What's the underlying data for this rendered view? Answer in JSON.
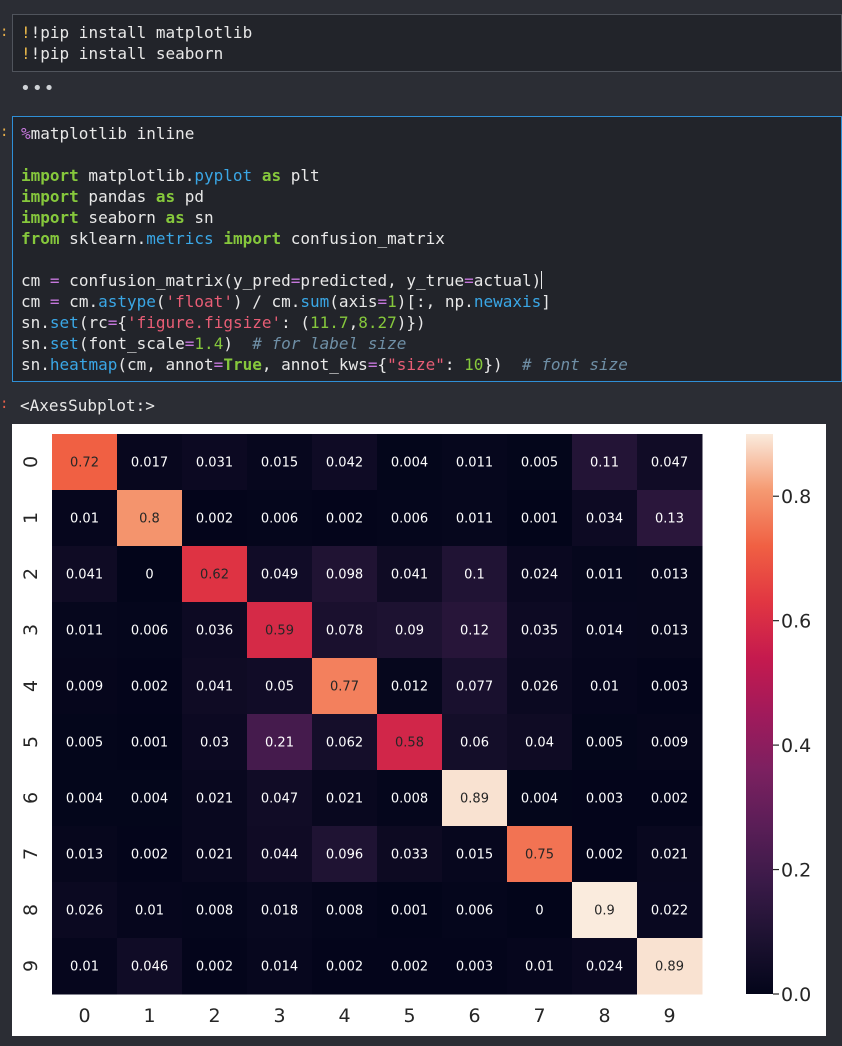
{
  "cells": {
    "cell1": {
      "lines": [
        "!pip install matplotlib",
        "!pip install seaborn"
      ]
    },
    "cell1_collapsed_indicator": "•••",
    "cell2": {
      "lines": [
        "%matplotlib inline",
        "",
        "import matplotlib.pyplot as plt",
        "import pandas as pd",
        "import seaborn as sn",
        "from sklearn.metrics import confusion_matrix",
        "",
        "cm = confusion_matrix(y_pred=predicted, y_true=actual)",
        "cm = cm.astype('float') / cm.sum(axis=1)[:, np.newaxis]",
        "sn.set(rc={'figure.figsize': (11.7,8.27)})",
        "sn.set(font_scale=1.4)  # for label size",
        "sn.heatmap(cm, annot=True, annot_kws={\"size\": 10})  # font size"
      ]
    },
    "output_text": "<AxesSubplot:>"
  },
  "chart_data": {
    "type": "heatmap",
    "x_categories": [
      "0",
      "1",
      "2",
      "3",
      "4",
      "5",
      "6",
      "7",
      "8",
      "9"
    ],
    "y_categories": [
      "0",
      "1",
      "2",
      "3",
      "4",
      "5",
      "6",
      "7",
      "8",
      "9"
    ],
    "values": [
      [
        0.72,
        0.017,
        0.031,
        0.015,
        0.042,
        0.004,
        0.011,
        0.005,
        0.11,
        0.047
      ],
      [
        0.01,
        0.8,
        0.002,
        0.006,
        0.002,
        0.006,
        0.011,
        0.001,
        0.034,
        0.13
      ],
      [
        0.041,
        0,
        0.62,
        0.049,
        0.098,
        0.041,
        0.1,
        0.024,
        0.011,
        0.013
      ],
      [
        0.011,
        0.006,
        0.036,
        0.59,
        0.078,
        0.09,
        0.12,
        0.035,
        0.014,
        0.013
      ],
      [
        0.009,
        0.002,
        0.041,
        0.05,
        0.77,
        0.012,
        0.077,
        0.026,
        0.01,
        0.003
      ],
      [
        0.005,
        0.001,
        0.03,
        0.21,
        0.062,
        0.58,
        0.06,
        0.04,
        0.005,
        0.009
      ],
      [
        0.004,
        0.004,
        0.021,
        0.047,
        0.021,
        0.008,
        0.89,
        0.004,
        0.003,
        0.002
      ],
      [
        0.013,
        0.002,
        0.021,
        0.044,
        0.096,
        0.033,
        0.015,
        0.75,
        0.002,
        0.021
      ],
      [
        0.026,
        0.01,
        0.008,
        0.018,
        0.008,
        0.001,
        0.006,
        0,
        0.9,
        0.022
      ],
      [
        0.01,
        0.046,
        0.002,
        0.014,
        0.002,
        0.002,
        0.003,
        0.01,
        0.024,
        0.89
      ]
    ],
    "colorbar": {
      "range": [
        0,
        0.9
      ],
      "ticks": [
        0.0,
        0.2,
        0.4,
        0.6,
        0.8
      ],
      "tick_labels": [
        "0.0",
        "0.2",
        "0.4",
        "0.6",
        "0.8"
      ]
    },
    "colormap": "rocket",
    "grid": false,
    "title": "",
    "xlabel": "",
    "ylabel": ""
  }
}
